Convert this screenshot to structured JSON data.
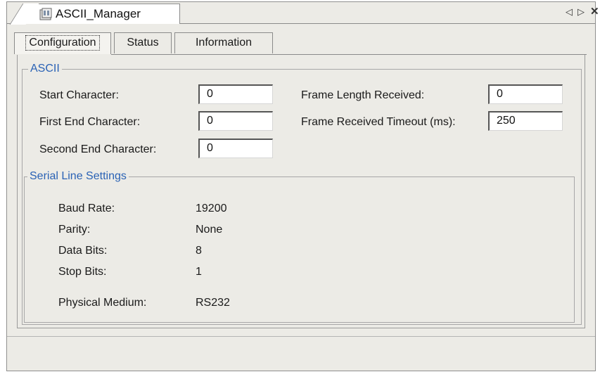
{
  "window": {
    "doc_tab_title": "ASCII_Manager",
    "nav_prev": "◁",
    "nav_next": "▷",
    "close": "✕"
  },
  "tabs": [
    {
      "label": "Configuration",
      "active": true
    },
    {
      "label": "Status",
      "active": false
    },
    {
      "label": "Information",
      "active": false
    }
  ],
  "ascii": {
    "legend": "ASCII",
    "start_char_label": "Start Character:",
    "start_char_value": "0",
    "first_end_label": "First End Character:",
    "first_end_value": "0",
    "second_end_label": "Second End Character:",
    "second_end_value": "0",
    "frame_length_label": "Frame Length Received:",
    "frame_length_value": "0",
    "frame_timeout_label": "Frame Received Timeout (ms):",
    "frame_timeout_value": "250"
  },
  "serial": {
    "legend": "Serial Line Settings",
    "baud_label": "Baud Rate:",
    "baud_value": "19200",
    "parity_label": "Parity:",
    "parity_value": "None",
    "data_bits_label": "Data Bits:",
    "data_bits_value": "8",
    "stop_bits_label": "Stop Bits:",
    "stop_bits_value": "1",
    "medium_label": "Physical Medium:",
    "medium_value": "RS232"
  },
  "colors": {
    "legend": "#2a62b5",
    "background": "#ecebe6"
  }
}
